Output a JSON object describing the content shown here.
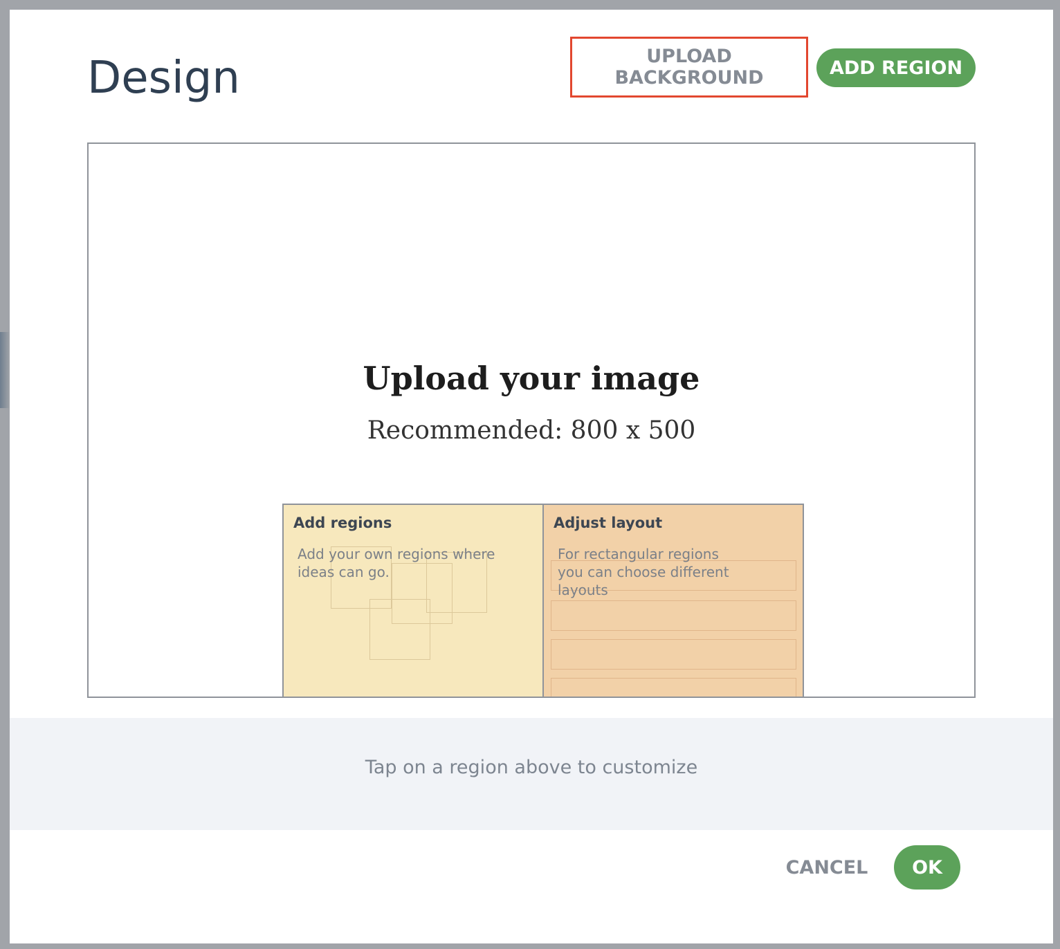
{
  "dialog": {
    "title": "Design"
  },
  "toolbar": {
    "upload_background_label": "UPLOAD BACKGROUND",
    "add_region_label": "ADD REGION"
  },
  "canvas": {
    "heading": "Upload your image",
    "subheading": "Recommended: 800 x 500",
    "panels": [
      {
        "title": "Add regions",
        "description": "Add your own regions where ideas can go."
      },
      {
        "title": "Adjust layout",
        "description": "For rectangular regions you can choose different layouts"
      }
    ]
  },
  "footer": {
    "hint": "Tap on a region above to customize",
    "cancel_label": "CANCEL",
    "ok_label": "OK"
  },
  "colors": {
    "accent_green": "#5ca25a",
    "highlight_red": "#e2472f",
    "title_text": "#2f3f52",
    "panel_yellow": "#f7e8bd",
    "panel_orange": "#f2d1a8"
  }
}
